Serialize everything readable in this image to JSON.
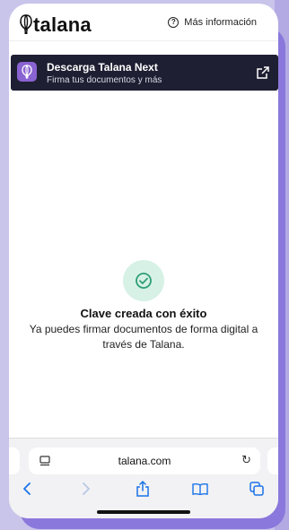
{
  "header": {
    "logo_text": "talana",
    "more_info_label": "Más información",
    "help_icon_glyph": "?"
  },
  "banner": {
    "title": "Descarga Talana Next",
    "subtitle": "Firma tus documentos y más",
    "bg_color": "#1f1f33",
    "icon_color": "#8a63d2"
  },
  "success": {
    "title": "Clave creada con éxito",
    "message": "Ya puedes firmar documentos de forma digital a través de Talana.",
    "icon": "check-circle-icon",
    "accent_color": "#2e9e78"
  },
  "browser": {
    "url": "talana.com",
    "reload_glyph": "↻",
    "nav_icons": [
      "back-icon",
      "forward-icon",
      "share-icon",
      "bookmarks-icon",
      "tabs-icon"
    ]
  },
  "colors": {
    "link_blue": "#1a73e8",
    "backdrop_purple": "#8b78dc",
    "page_lavender": "#c9c4ea"
  }
}
